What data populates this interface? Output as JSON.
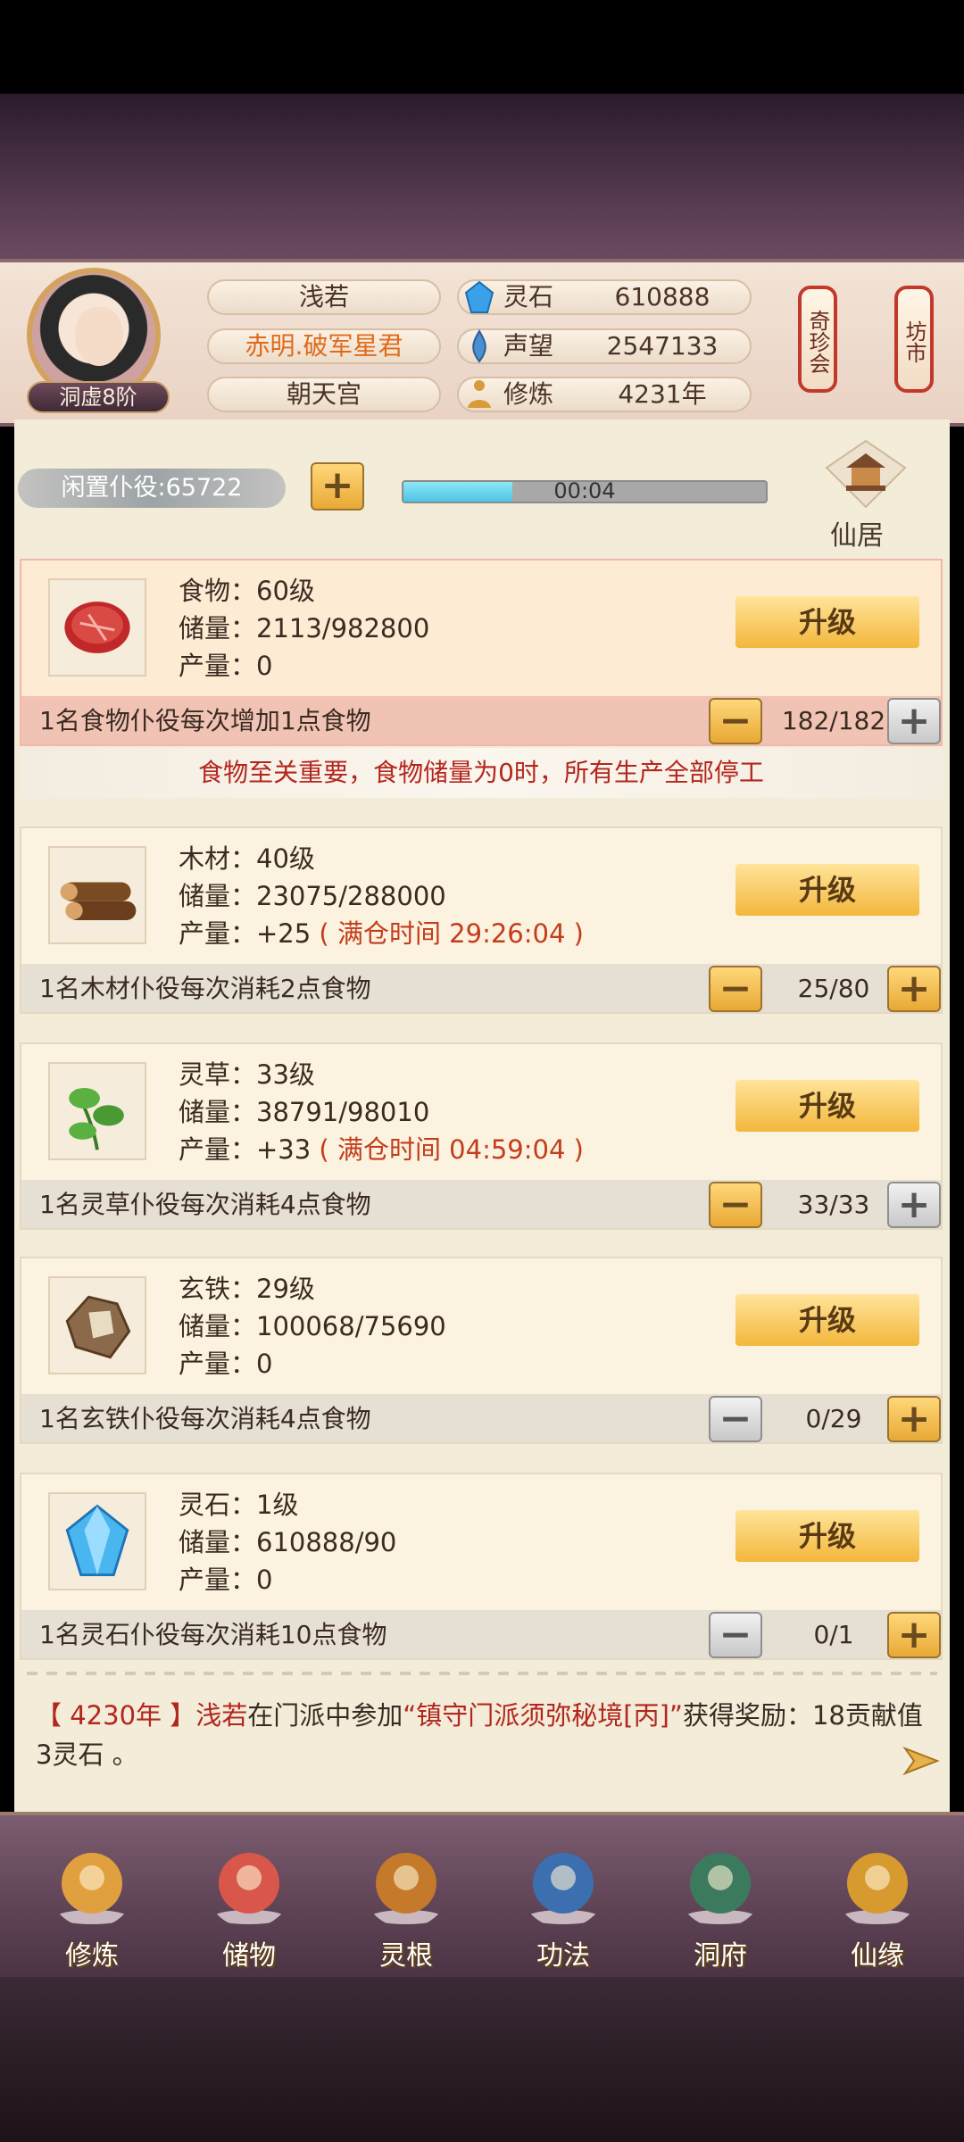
{
  "profile": {
    "name": "浅若",
    "title": "赤明.破军星君",
    "sect": "朝天宫",
    "rank": "洞虚8阶"
  },
  "stats": [
    {
      "label": "灵石",
      "value": "610888",
      "icon": "spirit-stone-icon",
      "color": "#3aa0e8"
    },
    {
      "label": "声望",
      "value": "2547133",
      "icon": "reputation-icon",
      "color": "#4a8fd0"
    },
    {
      "label": "修炼",
      "value": "4231年",
      "icon": "meditation-icon",
      "color": "#d99a3a"
    }
  ],
  "lanterns": [
    {
      "label": "奇珍会"
    },
    {
      "label": "坊市"
    }
  ],
  "idle": {
    "label": "闲置仆役:65722",
    "timer": "00:04",
    "progress": 0.3,
    "xianju": "仙居"
  },
  "resources": [
    {
      "name_line": "食物：60级",
      "storage_line": "储量：2113/982800",
      "output_prefix": "产量：0",
      "output_warn": "",
      "upgrade": "升级",
      "bar_text": "1名食物仆役每次增加1点食物",
      "count": "182/182",
      "minus_active": true,
      "plus_active": false,
      "highlight": true,
      "icon": "meat-icon"
    },
    {
      "name_line": "木材：40级",
      "storage_line": "储量：23075/288000",
      "output_prefix": "产量：+25",
      "output_warn": "( 满仓时间 29:26:04 )",
      "upgrade": "升级",
      "bar_text": "1名木材仆役每次消耗2点食物",
      "count": "25/80",
      "minus_active": true,
      "plus_active": true,
      "highlight": false,
      "icon": "wood-icon"
    },
    {
      "name_line": "灵草：33级",
      "storage_line": "储量：38791/98010",
      "output_prefix": "产量：+33",
      "output_warn": "( 满仓时间 04:59:04 )",
      "upgrade": "升级",
      "bar_text": "1名灵草仆役每次消耗4点食物",
      "count": "33/33",
      "minus_active": true,
      "plus_active": false,
      "highlight": false,
      "icon": "herb-icon"
    },
    {
      "name_line": "玄铁：29级",
      "storage_line": "储量：100068/75690",
      "output_prefix": "产量：0",
      "output_warn": "",
      "upgrade": "升级",
      "bar_text": "1名玄铁仆役每次消耗4点食物",
      "count": "0/29",
      "minus_active": false,
      "plus_active": true,
      "highlight": false,
      "icon": "iron-ore-icon"
    },
    {
      "name_line": "灵石：1级",
      "storage_line": "储量：610888/90",
      "output_prefix": "产量：0",
      "output_warn": "",
      "upgrade": "升级",
      "bar_text": "1名灵石仆役每次消耗10点食物",
      "count": "0/1",
      "minus_active": false,
      "plus_active": true,
      "highlight": false,
      "icon": "crystal-icon"
    }
  ],
  "warning": "食物至关重要，食物储量为0时，所有生产全部停工",
  "log": {
    "year": "【 4230年 】",
    "name": "浅若",
    "mid": "在门派中参加",
    "event": "“镇守门派须弥秘境[丙]”",
    "rest": "获得奖励：18贡献值 3灵石 。"
  },
  "nav": [
    {
      "label": "修炼",
      "icon": "meditation-icon",
      "color": "#e0a040"
    },
    {
      "label": "储物",
      "icon": "bag-icon",
      "color": "#d9574a"
    },
    {
      "label": "灵根",
      "icon": "spirit-root-icon",
      "color": "#c47a2a"
    },
    {
      "label": "功法",
      "icon": "book-icon",
      "color": "#3b6fb0"
    },
    {
      "label": "洞府",
      "icon": "cave-dwelling-icon",
      "color": "#3c7a5e"
    },
    {
      "label": "仙缘",
      "icon": "gourd-icon",
      "color": "#d79a2f"
    }
  ]
}
